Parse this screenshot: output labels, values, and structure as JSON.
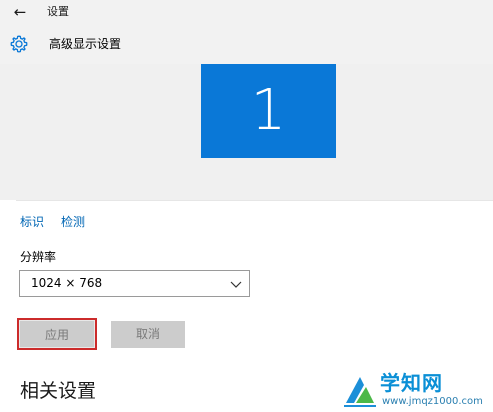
{
  "window": {
    "back_icon": "back-arrow-icon",
    "title": "设置"
  },
  "header": {
    "icon": "gear-icon",
    "title": "高级显示设置"
  },
  "display": {
    "monitor_number": "1",
    "tile_color": "#0a78d7",
    "identify_link": "标识",
    "detect_link": "检测"
  },
  "resolution": {
    "label": "分辨率",
    "value": "1024 × 768"
  },
  "actions": {
    "apply_label": "应用",
    "cancel_label": "取消",
    "apply_highlight_color": "#cc2b2b"
  },
  "related": {
    "heading": "相关设置"
  },
  "watermark": {
    "title": "学知网",
    "url": "www.jmqz1000.com"
  }
}
